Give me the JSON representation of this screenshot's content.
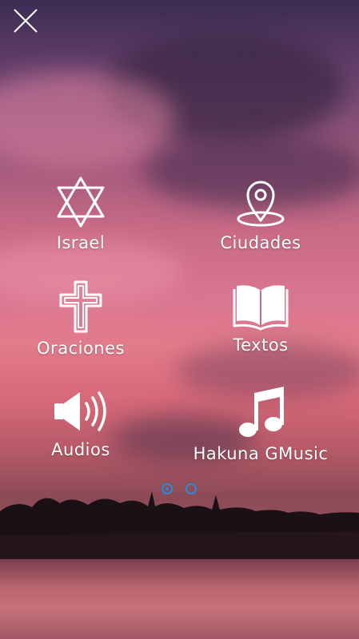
{
  "menu": {
    "items": [
      {
        "label": "Israel",
        "icon": "star-of-david-icon"
      },
      {
        "label": "Ciudades",
        "icon": "map-pin-icon"
      },
      {
        "label": "Oraciones",
        "icon": "cross-icon"
      },
      {
        "label": "Textos",
        "icon": "open-book-icon"
      },
      {
        "label": "Audios",
        "icon": "speaker-icon"
      },
      {
        "label": "Hakuna GMusic",
        "icon": "music-note-icon"
      }
    ]
  },
  "pager": {
    "pages": 2,
    "current": 1,
    "indicator_color": "#2a8bd8"
  },
  "colors": {
    "icon": "#ffffff",
    "label": "#ffffff"
  }
}
